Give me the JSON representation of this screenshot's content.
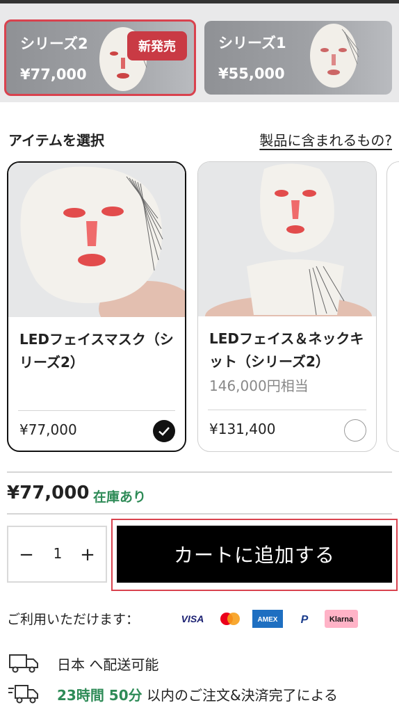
{
  "series": [
    {
      "name": "シリーズ2",
      "price": "¥77,000",
      "badge": "新発売",
      "selected": true
    },
    {
      "name": "シリーズ1",
      "price": "¥55,000",
      "selected": false
    }
  ],
  "items_section": {
    "title": "アイテムを選択",
    "whats_included_link": "製品に含まれるもの?"
  },
  "items": [
    {
      "name": "LEDフェイスマスク（シリーズ2）",
      "price": "¥77,000",
      "selected": true,
      "image_icon": "led-face-mask-icon"
    },
    {
      "name": "LEDフェイス＆ネックキット（シリーズ2）",
      "worth": "146,000円相当",
      "price": "¥131,400",
      "selected": false,
      "image_icon": "led-face-neck-kit-icon"
    }
  ],
  "summary": {
    "price": "¥77,000",
    "stock": "在庫あり"
  },
  "cart": {
    "quantity": "1",
    "minus": "−",
    "plus": "+",
    "add_label": "カートに追加する"
  },
  "payment": {
    "label": "ご利用いただけます：",
    "methods": [
      "VISA",
      "Mastercard",
      "AMEX",
      "PayPal",
      "Klarna"
    ]
  },
  "shipping": {
    "line1": "日本 へ配送可能",
    "line2_time": "23時間 50分",
    "line2_rest": " 以内のご注文&決済完了による"
  },
  "colors": {
    "accent_red": "#d9424e",
    "badge_red": "#c93a44",
    "stock_green": "#2e8b57",
    "button_black": "#000000"
  }
}
